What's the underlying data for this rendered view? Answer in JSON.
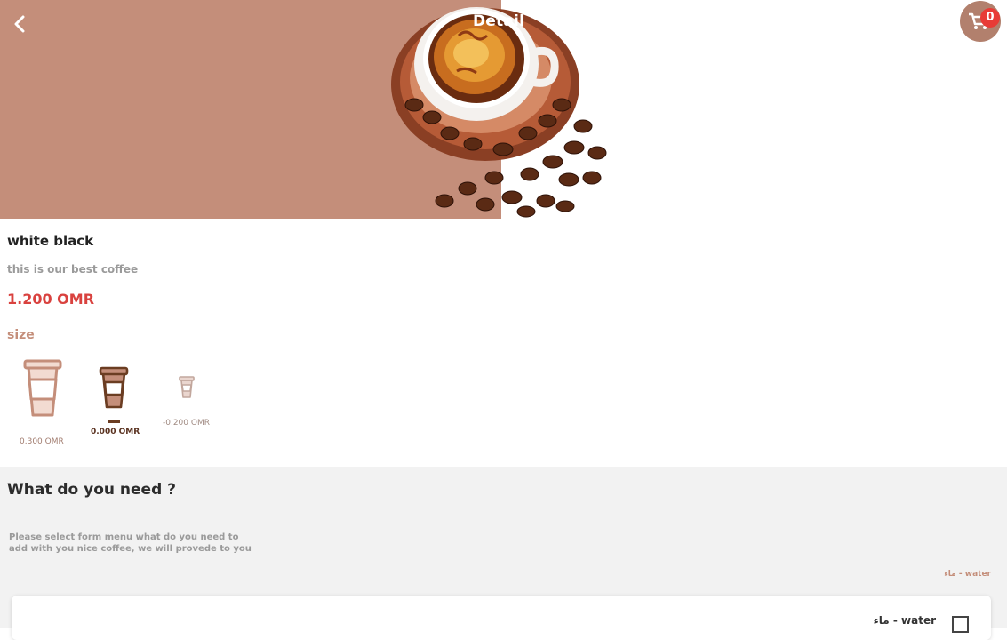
{
  "header": {
    "title": "Details",
    "back_icon": "chevron-left-icon",
    "cart_icon": "cart-icon",
    "cart_count": "0",
    "colors": {
      "banner": "#c48e7a",
      "badge": "#e83b36"
    }
  },
  "product": {
    "name": "white black",
    "description": "this is our best coffee",
    "price": "1.200 OMR",
    "image_icon": "coffee-cup-photo"
  },
  "size": {
    "label": "size",
    "options": [
      {
        "price": "0.300 OMR",
        "icon": "large-cup-icon",
        "selected": false
      },
      {
        "price": "0.000 OMR",
        "icon": "medium-cup-icon",
        "selected": true
      },
      {
        "price": "-0.200 OMR",
        "icon": "small-cup-icon",
        "selected": false
      }
    ]
  },
  "extras": {
    "title": "What do you need ?",
    "description": "Please select form menu what do you need to add with you nice coffee, we will provede to you",
    "group_label": "ماء - water",
    "items": [
      {
        "label": "ماء - water",
        "checked": false
      }
    ]
  }
}
